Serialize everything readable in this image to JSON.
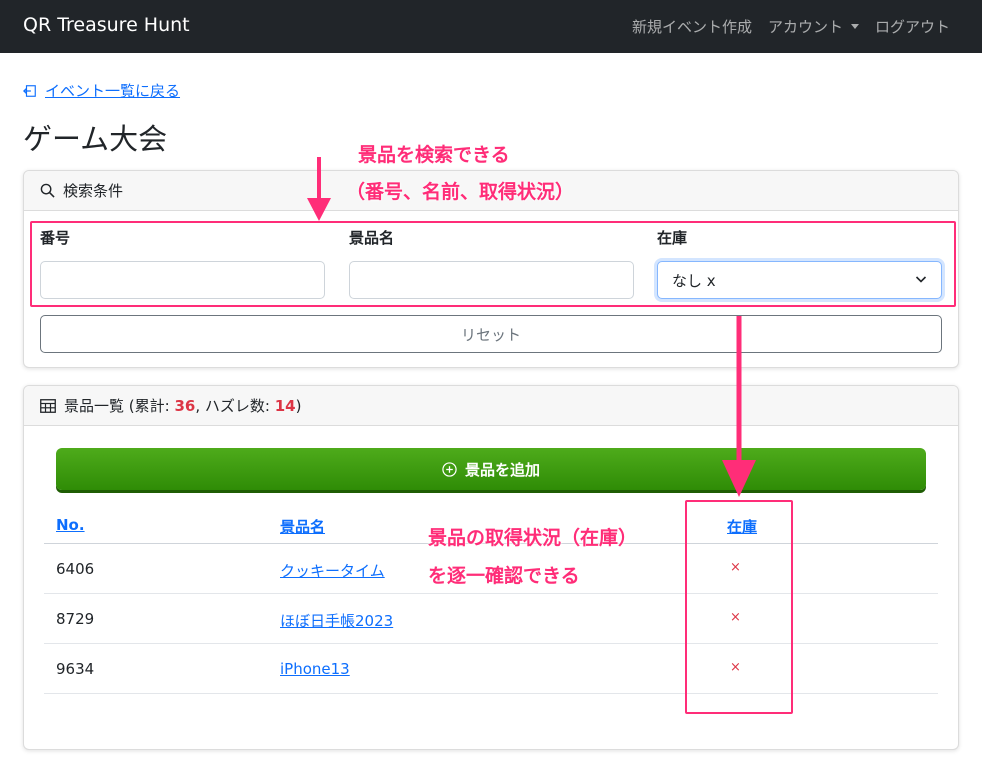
{
  "navbar": {
    "brand": "QR Treasure Hunt",
    "links": [
      "新規イベント作成",
      "アカウント",
      "ログアウト"
    ]
  },
  "back_link": "イベント一覧に戻る",
  "page_title": "ゲーム大会",
  "search": {
    "header": "検索条件",
    "fields": {
      "number_label": "番号",
      "name_label": "景品名",
      "stock_label": "在庫",
      "stock_value": "なし x"
    },
    "reset_label": "リセット"
  },
  "list": {
    "header_prefix": "景品一覧 (累計: ",
    "total": "36",
    "header_mid": ", ハズレ数: ",
    "misses": "14",
    "header_suffix": ")",
    "add_button": "景品を追加",
    "columns": [
      "No.",
      "景品名",
      "在庫"
    ],
    "rows": [
      {
        "no": "6406",
        "name": "クッキータイム",
        "stock": "×"
      },
      {
        "no": "8729",
        "name": "ほぼ日手帳2023",
        "stock": "×"
      },
      {
        "no": "9634",
        "name": "iPhone13",
        "stock": "×"
      }
    ]
  },
  "annotations": {
    "search_note_line1": "景品を検索できる",
    "search_note_line2": "（番号、名前、取得状況）",
    "stock_note_line1": "景品の取得状況（在庫）",
    "stock_note_line2": "を逐一確認できる"
  },
  "colors": {
    "navbar": "#212529",
    "link": "#0d6efd",
    "accent_red": "#dc3545",
    "add_button": "#3a9a0f",
    "annotation": "#ff2d78"
  }
}
